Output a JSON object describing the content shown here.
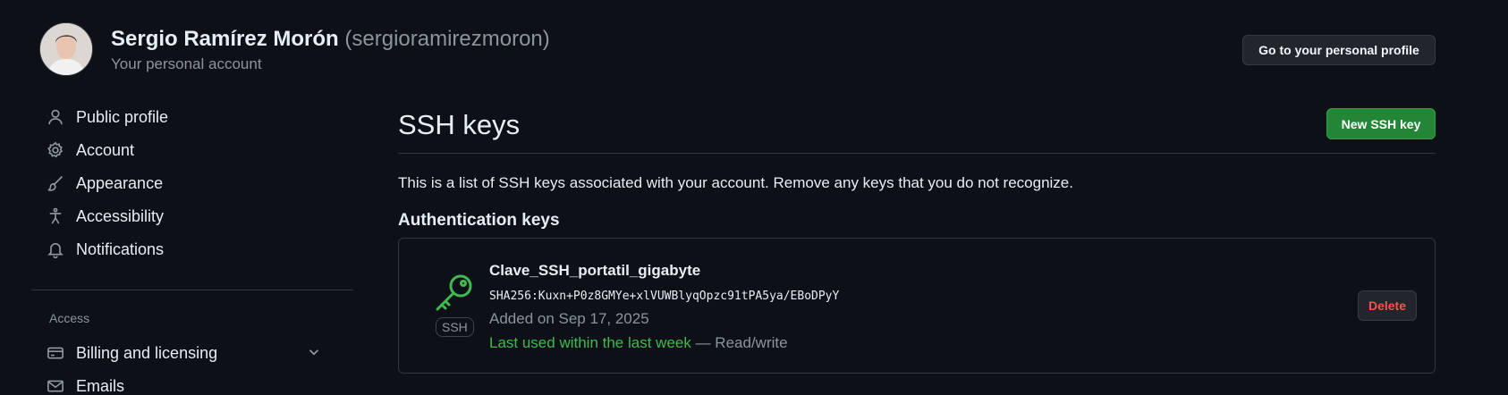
{
  "header": {
    "display_name": "Sergio Ramírez Morón",
    "login": "(sergioramirezmoron)",
    "subtitle": "Your personal account",
    "profile_button": "Go to your personal profile"
  },
  "sidebar": {
    "items": [
      {
        "label": "Public profile",
        "icon": "person-icon"
      },
      {
        "label": "Account",
        "icon": "gear-icon"
      },
      {
        "label": "Appearance",
        "icon": "paintbrush-icon"
      },
      {
        "label": "Accessibility",
        "icon": "accessibility-icon"
      },
      {
        "label": "Notifications",
        "icon": "bell-icon"
      }
    ],
    "access_heading": "Access",
    "access_items": [
      {
        "label": "Billing and licensing",
        "icon": "credit-card-icon"
      },
      {
        "label": "Emails",
        "icon": "mail-icon"
      }
    ]
  },
  "main": {
    "title": "SSH keys",
    "new_key_button": "New SSH key",
    "description": "This is a list of SSH keys associated with your account. Remove any keys that you do not recognize.",
    "section_heading": "Authentication keys",
    "keys": [
      {
        "title": "Clave_SSH_portatil_gigabyte",
        "fingerprint": "SHA256:Kuxn+P0z8GMYe+xlVUWBlyqOpzc91tPA5ya/EBoDPyY",
        "added": "Added on Sep 17, 2025",
        "last_used": "Last used within the last week",
        "access": " — Read/write",
        "badge": "SSH",
        "delete_label": "Delete"
      }
    ]
  },
  "colors": {
    "background": "#0d1117",
    "accent_green": "#238636",
    "recent_green": "#3fb950",
    "danger_red": "#f85149"
  }
}
